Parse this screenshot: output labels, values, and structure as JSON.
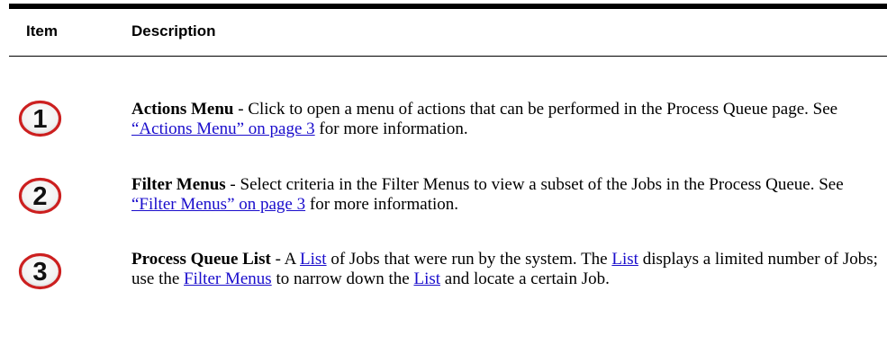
{
  "header": {
    "item": "Item",
    "description": "Description"
  },
  "rows": [
    {
      "number": "1",
      "title": "Actions Menu",
      "sep": " - ",
      "text1": "Click to open a menu of actions that can be performed in the Process Queue page. See ",
      "link1": "“Actions Menu” on page 3",
      "text2": " for more information."
    },
    {
      "number": "2",
      "title": "Filter Menus",
      "sep": " - ",
      "text1": "Select criteria in the Filter Menus to view a subset of the Jobs in the Process Queue. See ",
      "link1": "“Filter Menus” on page 3",
      "text2": " for more information."
    },
    {
      "number": "3",
      "title": "Process Queue List",
      "sep": " - A ",
      "link_list_1": "List",
      "text1": " of Jobs that were run by the system. The ",
      "link_list_2": "List",
      "text2": " displays a limited number of Jobs; use the ",
      "link_filter": "Filter Menus",
      "text3": " to narrow down the ",
      "link_list_3": "List",
      "text4": " and locate a certain Job."
    }
  ],
  "colors": {
    "badge_ring": "#cc1f1f",
    "link": "#1a0dcc"
  }
}
